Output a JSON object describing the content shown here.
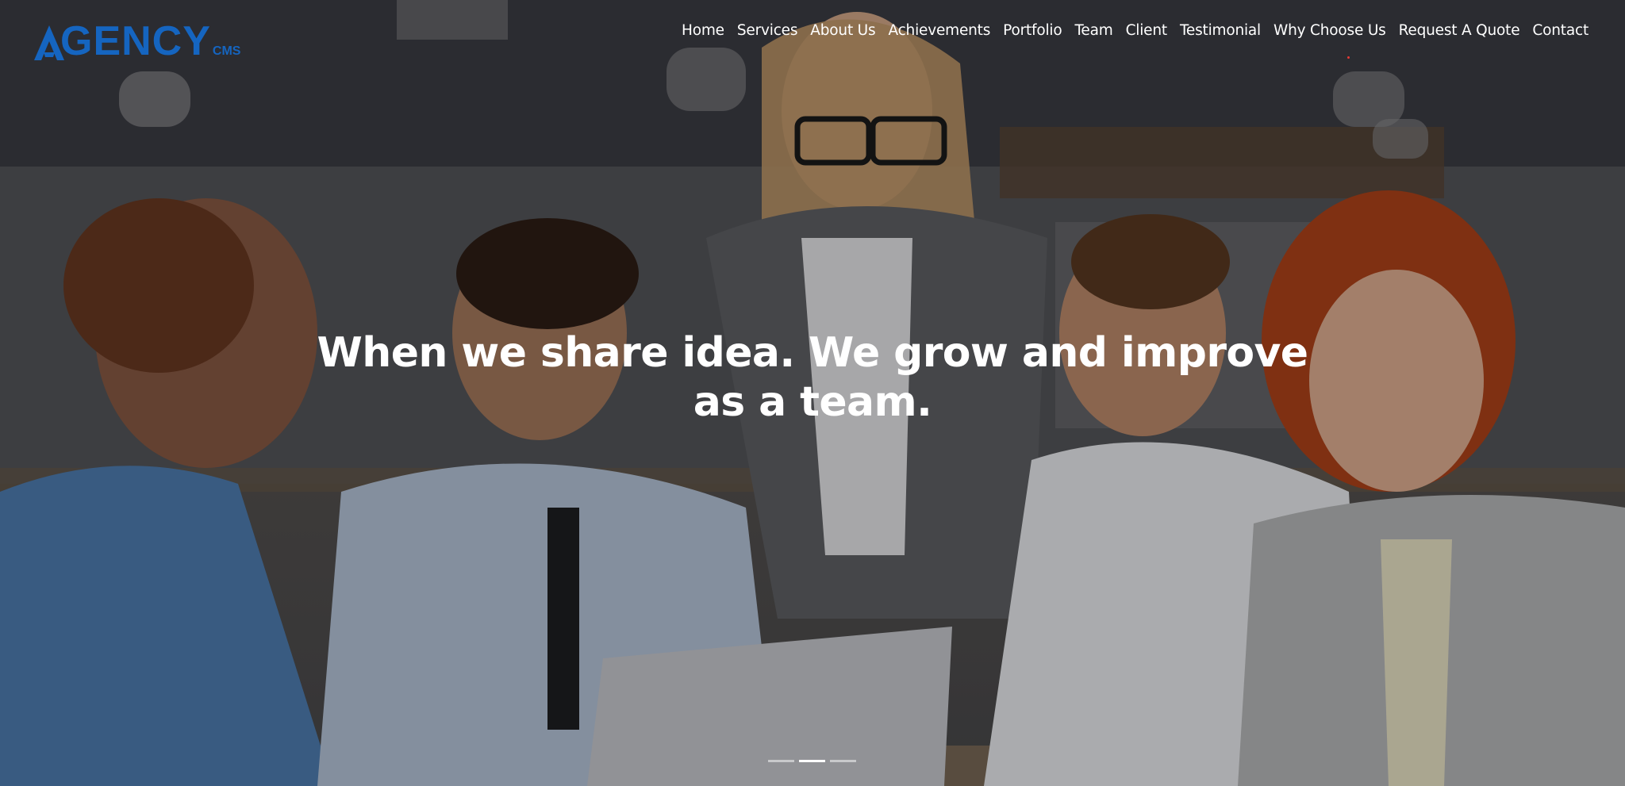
{
  "brand": {
    "name": "GENCY",
    "suffix": "CMS",
    "accent_color": "#1565c0",
    "icon": "triangle-a-logo-icon"
  },
  "nav": {
    "items": [
      {
        "label": "Home"
      },
      {
        "label": "Services"
      },
      {
        "label": "About Us"
      },
      {
        "label": "Achievements"
      },
      {
        "label": "Portfolio"
      },
      {
        "label": "Team"
      },
      {
        "label": "Client"
      },
      {
        "label": "Testimonial"
      },
      {
        "label": "Why Choose Us"
      },
      {
        "label": "Request A Quote"
      },
      {
        "label": "Contact"
      }
    ]
  },
  "hero": {
    "headline_line1": "When we share idea. We grow and improve",
    "headline_line2": "as a team.",
    "slides_total": 3,
    "active_slide": 2
  }
}
